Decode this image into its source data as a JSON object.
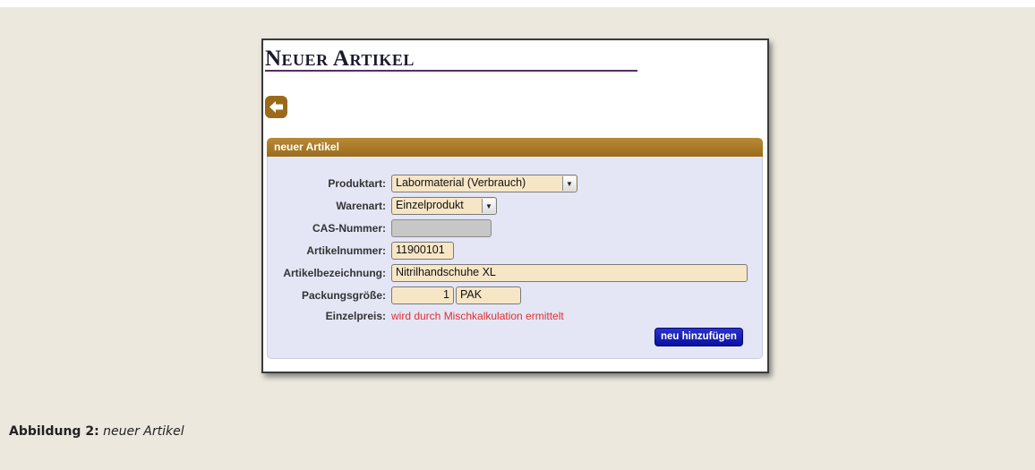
{
  "page": {
    "title": "Neuer Artikel"
  },
  "panel": {
    "header": "neuer Artikel"
  },
  "form": {
    "produktart": {
      "label": "Produktart:",
      "value": "Labormaterial (Verbrauch)"
    },
    "warenart": {
      "label": "Warenart:",
      "value": "Einzelprodukt"
    },
    "cas_nummer": {
      "label": "CAS-Nummer:",
      "value": ""
    },
    "artikelnummer": {
      "label": "Artikelnummer:",
      "value": "11900101"
    },
    "artikelbezeichnung": {
      "label": "Artikelbezeichnung:",
      "value": "Nitrilhandschuhe XL"
    },
    "packungsgroesse": {
      "label": "Packungsgröße:",
      "quantity": "1",
      "unit": "PAK"
    },
    "einzelpreis": {
      "label": "Einzelpreis:",
      "value": "wird durch Mischkalkulation ermittelt"
    },
    "submit_label": "neu hinzufügen"
  },
  "caption": {
    "prefix": "Abbildung 2:",
    "text": "neuer Artikel"
  },
  "icons": {
    "back": "arrow-left-icon",
    "dropdown": "chevron-down-icon"
  },
  "colors": {
    "accent": "#9a6c1c",
    "panel_background": "#e4e6f6",
    "input_background": "#f7e6c6",
    "button": "#0a10a0",
    "price_text": "#e03030"
  }
}
